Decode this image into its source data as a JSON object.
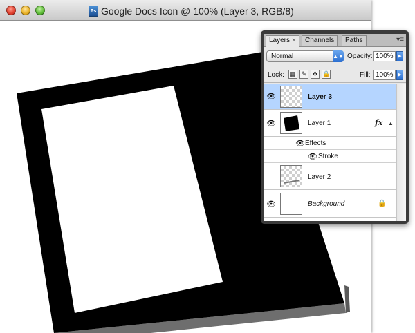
{
  "window": {
    "title": "Google Docs Icon @ 100% (Layer 3, RGB/8)",
    "app_icon": "photoshop-file-icon",
    "app_icon_text": "Ps"
  },
  "palette": {
    "tabs": [
      {
        "label": "Layers",
        "active": true,
        "close": "×"
      },
      {
        "label": "Channels",
        "active": false
      },
      {
        "label": "Paths",
        "active": false
      }
    ],
    "menu_glyph": "▾≡",
    "blend_mode": "Normal",
    "opacity_label": "Opacity:",
    "opacity_value": "100%",
    "lock_label": "Lock:",
    "fill_label": "Fill:",
    "fill_value": "100%",
    "lock_glyphs": [
      "▦",
      "✎",
      "✥",
      "🔒"
    ],
    "layers": [
      {
        "name": "Layer 3",
        "selected": true,
        "visible": true,
        "thumb": "transparent"
      },
      {
        "name": "Layer 1",
        "selected": false,
        "visible": true,
        "thumb": "black-shape",
        "fx": "fx",
        "effects_label": "Effects",
        "stroke_label": "Stroke"
      },
      {
        "name": "Layer 2",
        "selected": false,
        "visible": false,
        "thumb": "transparent"
      },
      {
        "name": "Background",
        "selected": false,
        "visible": true,
        "thumb": "white",
        "locked": true
      }
    ]
  },
  "glyphs": {
    "eye": "👁",
    "expander": "▲",
    "lock": "🔒",
    "dropdown": "▲▼",
    "triangle": "▶"
  },
  "colors": {
    "selected_row": "#b5d5ff",
    "accent_blue": "#2b6fd1",
    "palette_frame": "#3b3b3b"
  }
}
